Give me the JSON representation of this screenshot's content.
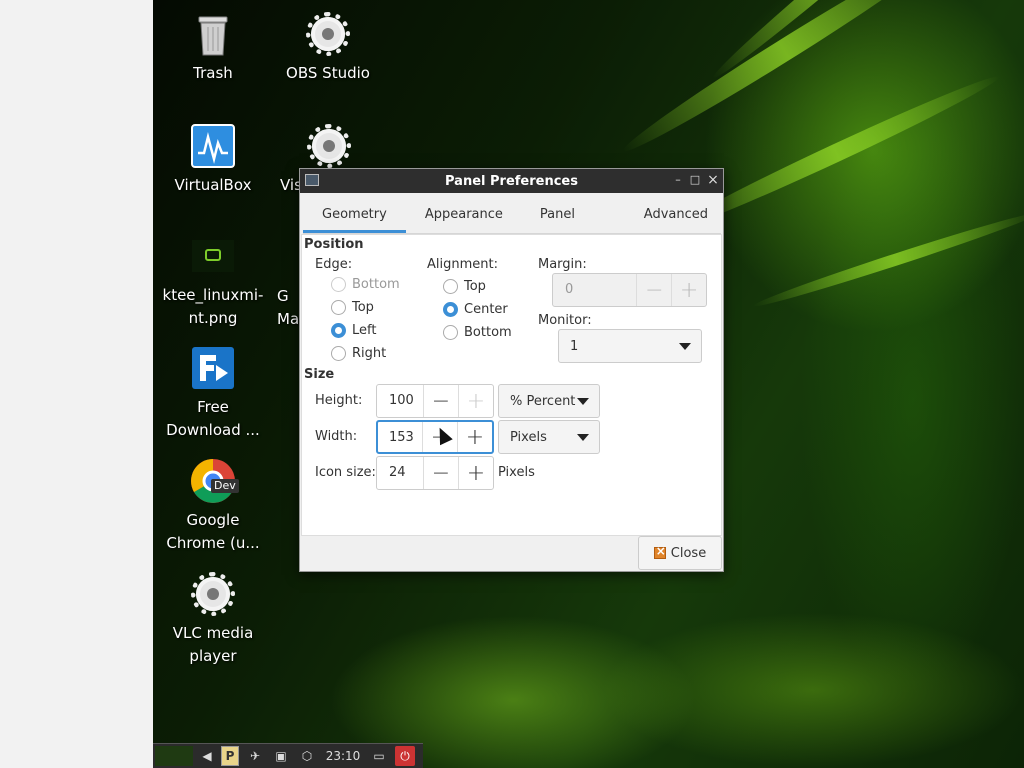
{
  "desktop": {
    "icons": [
      {
        "label": "Trash"
      },
      {
        "label": "OBS Studio"
      },
      {
        "label": "VirtualBox"
      },
      {
        "label": "Vis"
      },
      {
        "label": "ktee_linuxmi-nt.png"
      },
      {
        "label": "G Ma"
      },
      {
        "label": "Free Download ..."
      },
      {
        "label": "Google Chrome (u..."
      },
      {
        "label": "VLC media player"
      }
    ],
    "chrome_badge": "Dev"
  },
  "taskbar": {
    "clock": "23:10",
    "pager_label": "P"
  },
  "window": {
    "title": "Panel Preferences",
    "buttons": {
      "minimize": "–",
      "maximize": "□",
      "close": "×"
    },
    "tabs": [
      {
        "label": "Geometry",
        "active": true
      },
      {
        "label": "Appearance",
        "active": false
      },
      {
        "label": "Panel Applets",
        "active": false
      },
      {
        "label": "Advanced",
        "active": false
      }
    ],
    "position": {
      "heading": "Position",
      "edge_label": "Edge:",
      "edge_options": [
        "Bottom",
        "Top",
        "Left",
        "Right"
      ],
      "edge_selected": "Left",
      "alignment_label": "Alignment:",
      "alignment_options": [
        "Top",
        "Center",
        "Bottom"
      ],
      "alignment_selected": "Center",
      "margin_label": "Margin:",
      "margin_value": "0",
      "monitor_label": "Monitor:",
      "monitor_value": "1"
    },
    "size": {
      "heading": "Size",
      "height_label": "Height:",
      "height_value": "100",
      "height_unit": "% Percent",
      "width_label": "Width:",
      "width_value": "153",
      "width_unit": "Pixels",
      "icon_size_label": "Icon size:",
      "icon_size_value": "24",
      "icon_size_unit": "Pixels"
    },
    "close_label": "Close"
  },
  "colors": {
    "accent": "#3c8fd6",
    "titlebar": "#2e2e2e"
  }
}
